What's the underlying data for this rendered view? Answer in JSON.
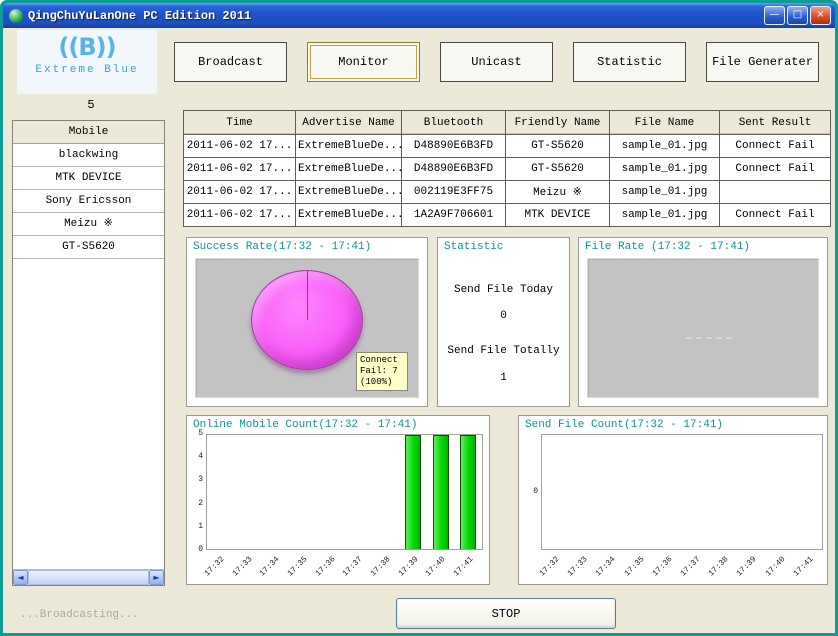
{
  "window": {
    "title": "QingChuYuLanOne PC Edition 2011",
    "controls": {
      "minimize": "—",
      "maximize": "□",
      "close": "×"
    }
  },
  "icons": {
    "app_icon": "green-orb-icon",
    "scroll_left": "◄",
    "scroll_right": "►"
  },
  "logo": {
    "symbol": "((B))",
    "text": "Extreme Blue"
  },
  "toolbar": {
    "buttons": [
      "Broadcast",
      "Monitor",
      "Unicast",
      "Statistic",
      "File Generater"
    ],
    "active_button": "Monitor"
  },
  "sidebar": {
    "count": "5",
    "header": "Mobile",
    "items": [
      "blackwing",
      "MTK DEVICE",
      "Sony Ericsson",
      "Meizu ※",
      "GT-S5620"
    ]
  },
  "table": {
    "headers": [
      "Time",
      "Advertise Name",
      "Bluetooth",
      "Friendly Name",
      "File Name",
      "Sent Result"
    ],
    "rows": [
      [
        "2011-06-02 17...",
        "ExtremeBlueDe...",
        "D48890E6B3FD",
        "GT-S5620",
        "sample_01.jpg",
        "Connect Fail"
      ],
      [
        "2011-06-02 17...",
        "ExtremeBlueDe...",
        "D48890E6B3FD",
        "GT-S5620",
        "sample_01.jpg",
        "Connect Fail"
      ],
      [
        "2011-06-02 17...",
        "ExtremeBlueDe...",
        "002119E3FF75",
        "Meizu ※",
        "sample_01.jpg",
        ""
      ],
      [
        "2011-06-02 17...",
        "ExtremeBlueDe...",
        "1A2A9F706601",
        "MTK DEVICE",
        "sample_01.jpg",
        "Connect Fail"
      ]
    ]
  },
  "chart_data": [
    {
      "id": "success-rate",
      "type": "pie",
      "title": "Success Rate(17:32 - 17:41)",
      "time_range": "17:32 - 17:41",
      "slices": [
        {
          "label": "Connect Fail",
          "value": 7,
          "percent": 100,
          "color": "#f95cf9"
        }
      ],
      "tooltip": "Connect Fail: 7 (100%)"
    },
    {
      "id": "statistic",
      "type": "table",
      "title": "Statistic",
      "rows": [
        [
          "Send File Today",
          "0"
        ],
        [
          "Send File Totally",
          "1"
        ]
      ]
    },
    {
      "id": "file-rate",
      "type": "line",
      "title": "File Rate (17:32 - 17:41)",
      "time_range": "17:32 - 17:41",
      "x": [],
      "series": [],
      "note": "empty plot, no data"
    },
    {
      "id": "online-mobile-count",
      "type": "bar",
      "title": "Online Mobile Count(17:32 - 17:41)",
      "time_range": "17:32 - 17:41",
      "categories": [
        "17:32",
        "17:33",
        "17:34",
        "17:35",
        "17:36",
        "17:37",
        "17:38",
        "17:39",
        "17:40",
        "17:41"
      ],
      "values": [
        0,
        0,
        0,
        0,
        0,
        0,
        0,
        5,
        5,
        5
      ],
      "ymax": 5,
      "ylim": [
        0,
        5
      ],
      "yticks": [
        5,
        4,
        3,
        2,
        1,
        0
      ],
      "bar_color": "#00dc00"
    },
    {
      "id": "send-file-count",
      "type": "bar",
      "title": "Send File Count(17:32 - 17:41)",
      "time_range": "17:32 - 17:41",
      "categories": [
        "17:32",
        "17:33",
        "17:34",
        "17:35",
        "17:36",
        "17:37",
        "17:38",
        "17:39",
        "17:40",
        "17:41"
      ],
      "values": [
        0,
        0,
        0,
        0,
        0,
        0,
        0,
        0,
        0,
        0
      ],
      "ymax": 5,
      "yticks": [
        "0"
      ],
      "bar_color": "#00dc00"
    }
  ],
  "statusbar": {
    "text": "...Broadcasting...",
    "stop_label": "STOP"
  },
  "colors": {
    "window_border": "#0e9c94",
    "titlebar_blue": "#1e52c8",
    "background": "#ece9d8",
    "chart_title": "#0f9494",
    "pie_magenta": "#f95cf9",
    "bar_green": "#00dc00",
    "tooltip_bg": "#ffffc8",
    "plot_gray": "#c3c3c3"
  }
}
